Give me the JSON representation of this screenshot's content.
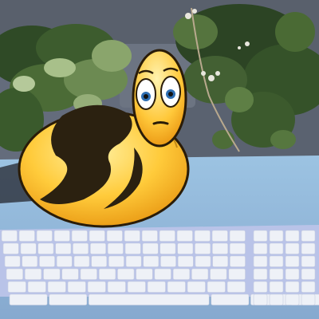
{
  "scene": {
    "description_items": [
      "garden-wall-background",
      "climbing-plants",
      "blue-desk-mat",
      "white-keyboard",
      "yellow-cartoon-snail-mascot"
    ],
    "colors": {
      "wall": "#6b7382",
      "wall_shadow": "#3d4450",
      "foliage_dark": "#2f4a26",
      "foliage_light": "#7f9c62",
      "desk_mat": "#8fb6d8",
      "keyboard_body": "#b9c3e8",
      "key": "#eef1f7",
      "mascot_yellow": "#ffc93a",
      "mascot_outline": "#2a1c08",
      "mascot_stripe": "#2b2110"
    }
  },
  "keyboard": {
    "row_keys": [
      14,
      14,
      14,
      13,
      12,
      6
    ],
    "numpad_rows": 6
  }
}
